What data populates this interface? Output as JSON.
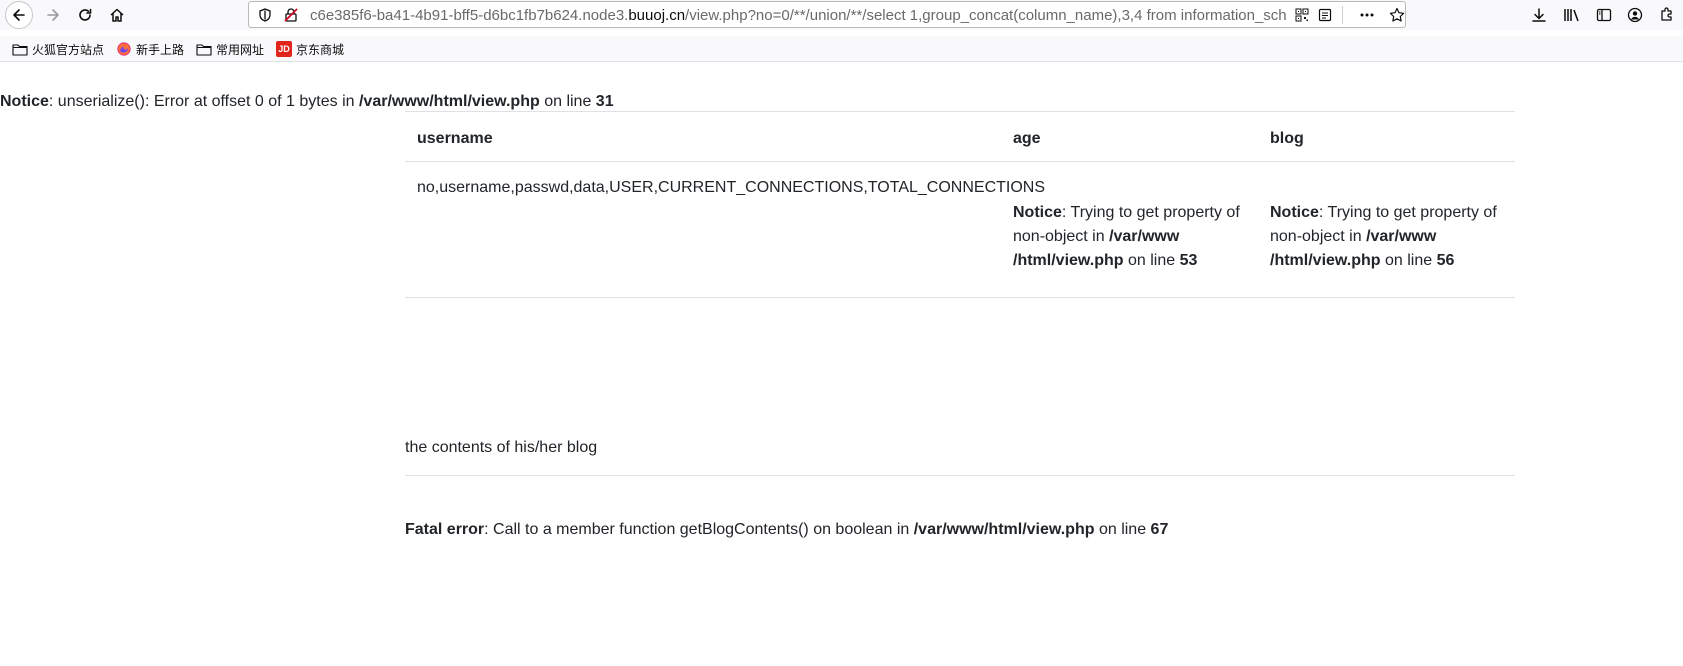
{
  "browser": {
    "url": {
      "prefix": "c6e385f6-ba41-4b91-bff5-d6bc1fb7b624.node3.",
      "domain": "buuoj.cn",
      "path": "/view.php?no=0/**/union/**/select 1,group_concat(column_name),3,4 from information_sch"
    },
    "bookmarks": [
      {
        "label": "火狐官方站点",
        "icon": "folder-icon"
      },
      {
        "label": "新手上路",
        "icon": "firefox-icon"
      },
      {
        "label": "常用网址",
        "icon": "folder-icon"
      },
      {
        "label": "京东商城",
        "icon": "jd-icon",
        "badge": "JD"
      }
    ]
  },
  "page": {
    "notice_top": {
      "label": "Notice",
      "message": ": unserialize(): Error at offset 0 of 1 bytes in ",
      "file": "/var/www/html/view.php",
      "on_line": " on line ",
      "line": "31"
    },
    "table": {
      "headers": [
        "username",
        "age",
        "blog"
      ],
      "username_value": "no,username,passwd,data,USER,CURRENT_CONNECTIONS,TOTAL_CONNECTIONS",
      "age_notice": {
        "label": "Notice",
        "message": ": Trying to get property of non-object in ",
        "file": "/var/www /html/view.php",
        "on_line": " on line ",
        "line": "53"
      },
      "blog_notice": {
        "label": "Notice",
        "message": ": Trying to get property of non-object in ",
        "file": "/var/www /html/view.php",
        "on_line": " on line ",
        "line": "56"
      }
    },
    "blog_text": "the contents of his/her blog",
    "fatal_error": {
      "label": "Fatal error",
      "message": ": Call to a member function getBlogContents() on boolean in ",
      "file": "/var/www/html/view.php",
      "on_line": " on line ",
      "line": "67"
    }
  }
}
